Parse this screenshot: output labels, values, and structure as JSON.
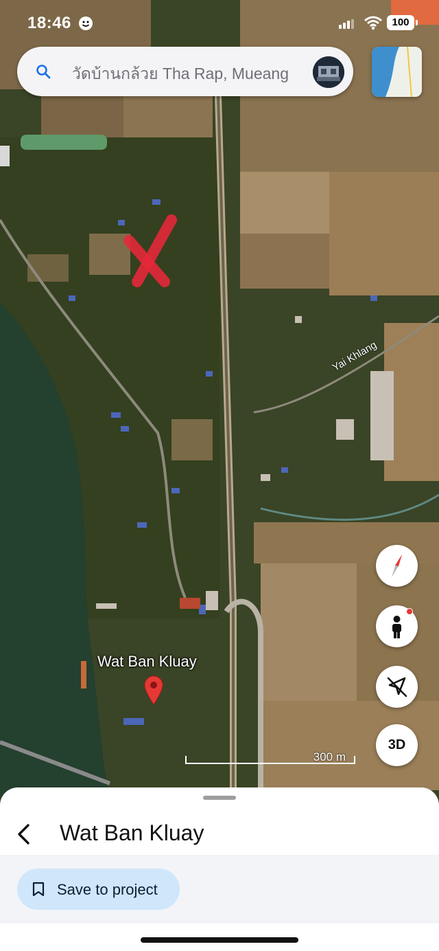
{
  "status_bar": {
    "time": "18:46",
    "battery": "100"
  },
  "search": {
    "query": "วัดบ้านกล้วย Tha Rap, Mueang"
  },
  "map": {
    "road_label": "Yai Khlang",
    "place_label": "Wat Ban Kluay",
    "scale_label": "300 m"
  },
  "controls": {
    "three_d": "3D"
  },
  "sheet": {
    "title": "Wat Ban Kluay",
    "save_label": "Save to project"
  },
  "colors": {
    "save_bg": "#cfe6fb",
    "pin": "#e53935",
    "mark": "#e8283a",
    "search_icon": "#1a73e8"
  },
  "icons": [
    "search-icon",
    "avatar-icon",
    "layers-thumbnail-icon",
    "compass-icon",
    "street-view-icon",
    "location-off-icon",
    "map-pin-icon",
    "back-chevron-icon",
    "bookmark-icon",
    "smile-face-icon",
    "signal-icon",
    "wifi-icon"
  ]
}
